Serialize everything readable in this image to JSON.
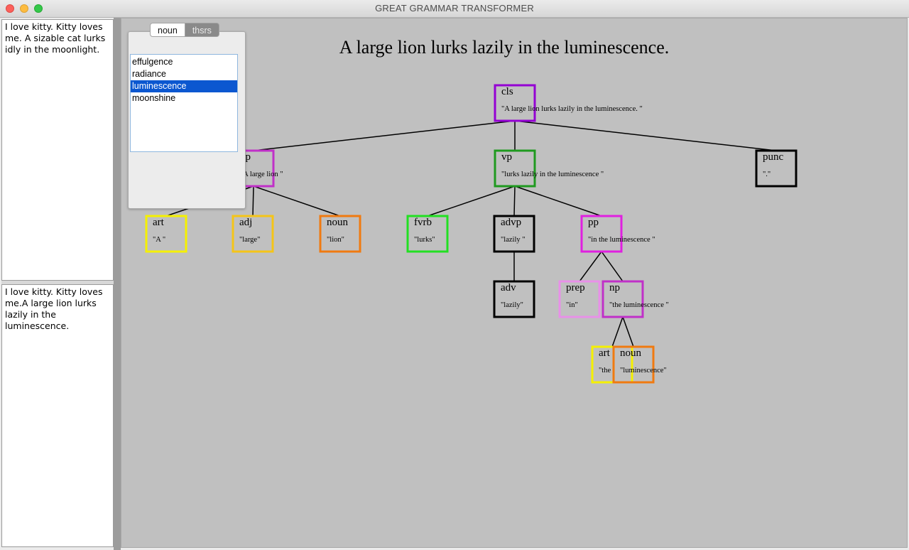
{
  "window": {
    "title": "GREAT GRAMMAR TRANSFORMER"
  },
  "text_panes": {
    "top": "I love kitty. Kitty loves me. A sizable cat lurks idly in the moonlight.",
    "bottom": "I love kitty. Kitty loves me.A large lion lurks lazily in the luminescence."
  },
  "thesaurus": {
    "tabs": [
      "noun",
      "thsrs"
    ],
    "active_tab": "noun",
    "synonyms": [
      "effulgence",
      "radiance",
      "luminescence",
      "moonshine"
    ],
    "selected": "luminescence"
  },
  "sentence": "A large lion lurks lazily in the luminescence.",
  "tree": {
    "nodes": [
      {
        "id": "cls",
        "label": "cls",
        "text": "\"A large lion lurks lazily in the luminescence. \"",
        "color": "#9400d3"
      },
      {
        "id": "np1",
        "label": "np",
        "text": "\"A large lion \"",
        "color": "#c030c8"
      },
      {
        "id": "vp",
        "label": "vp",
        "text": "\"lurks lazily in the luminescence \"",
        "color": "#1f9a1f"
      },
      {
        "id": "punc",
        "label": "punc",
        "text": "\".\"",
        "color": "#000000"
      },
      {
        "id": "art1",
        "label": "art",
        "text": "\"A \"",
        "color": "#f5f000"
      },
      {
        "id": "adj",
        "label": "adj",
        "text": "\"large\"",
        "color": "#f5c518"
      },
      {
        "id": "noun1",
        "label": "noun",
        "text": "\"lion\"",
        "color": "#f07a10"
      },
      {
        "id": "fvrb",
        "label": "fvrb",
        "text": "\"lurks\"",
        "color": "#22e022"
      },
      {
        "id": "advp",
        "label": "advp",
        "text": "\"lazily \"",
        "color": "#000000"
      },
      {
        "id": "pp",
        "label": "pp",
        "text": "\"in the luminescence \"",
        "color": "#e020e0"
      },
      {
        "id": "adv",
        "label": "adv",
        "text": "\"lazily\"",
        "color": "#000000"
      },
      {
        "id": "prep",
        "label": "prep",
        "text": "\"in\"",
        "color": "#e890e8"
      },
      {
        "id": "np2",
        "label": "np",
        "text": "\"the luminescence \"",
        "color": "#c030c8"
      },
      {
        "id": "art2",
        "label": "art",
        "text": "\"the",
        "color": "#f5f000"
      },
      {
        "id": "noun2",
        "label": "noun",
        "text": "\"luminescence\"",
        "color": "#f07a10"
      }
    ],
    "edges": [
      [
        "cls",
        "np1"
      ],
      [
        "cls",
        "vp"
      ],
      [
        "cls",
        "punc"
      ],
      [
        "np1",
        "art1"
      ],
      [
        "np1",
        "adj"
      ],
      [
        "np1",
        "noun1"
      ],
      [
        "vp",
        "fvrb"
      ],
      [
        "vp",
        "advp"
      ],
      [
        "vp",
        "pp"
      ],
      [
        "advp",
        "adv"
      ],
      [
        "pp",
        "prep"
      ],
      [
        "pp",
        "np2"
      ],
      [
        "np2",
        "art2"
      ],
      [
        "np2",
        "noun2"
      ]
    ]
  }
}
